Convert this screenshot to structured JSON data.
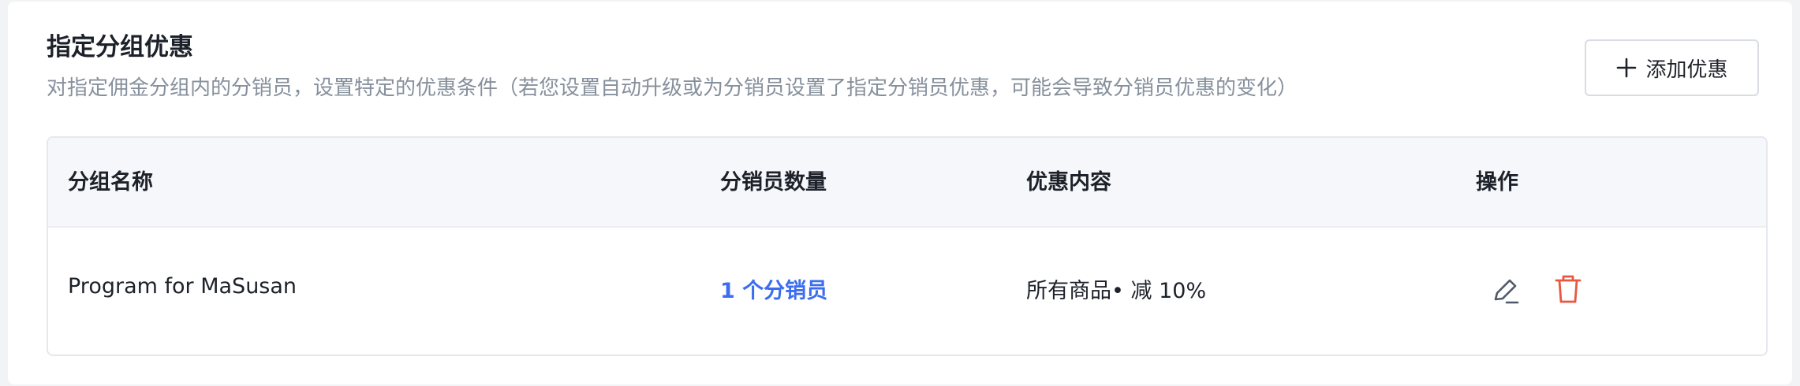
{
  "header": {
    "title": "指定分组优惠",
    "description": "对指定佣金分组内的分销员，设置特定的优惠条件（若您设置自动升级或为分销员设置了指定分销员优惠，可能会导致分销员优惠的变化）",
    "add_button_label": "添加优惠",
    "add_button_icon": "plus-icon"
  },
  "table": {
    "columns": [
      "分组名称",
      "分销员数量",
      "优惠内容",
      "操作"
    ],
    "rows": [
      {
        "group_name": "Program for MaSusan",
        "member_count": "1 个分销员",
        "discount": "所有商品• 减 10%",
        "actions": [
          "edit-icon",
          "delete-icon"
        ]
      }
    ]
  },
  "colors": {
    "link": "#3a6df0",
    "delete": "#e8583f",
    "edit": "#4e5969",
    "text": "#1d2129",
    "muted": "#86909c"
  }
}
